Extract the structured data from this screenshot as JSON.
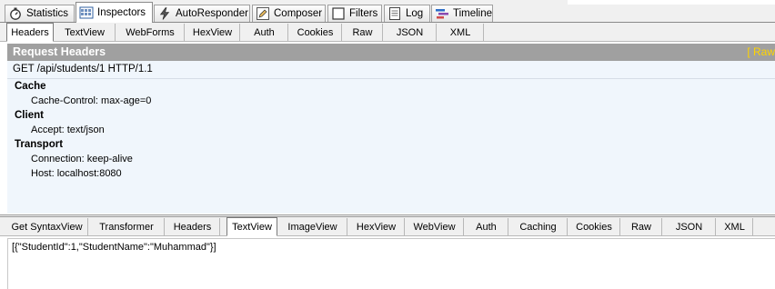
{
  "top_tabs": [
    {
      "label": "Statistics",
      "icon": "stopwatch-icon"
    },
    {
      "label": "Inspectors",
      "icon": "inspect-icon"
    },
    {
      "label": "AutoResponder",
      "icon": "lightning-icon"
    },
    {
      "label": "Composer",
      "icon": "pencil-icon"
    },
    {
      "label": "Filters",
      "icon": "checkbox-icon"
    },
    {
      "label": "Log",
      "icon": "document-icon"
    },
    {
      "label": "Timeline",
      "icon": "timeline-icon"
    }
  ],
  "request_tabs": [
    "Headers",
    "TextView",
    "WebForms",
    "HexView",
    "Auth",
    "Cookies",
    "Raw",
    "JSON",
    "XML"
  ],
  "request_headers": {
    "title": "Request Headers",
    "raw_link": "[ Raw",
    "request_line": "GET /api/students/1 HTTP/1.1",
    "groups": [
      {
        "name": "Cache",
        "items": [
          "Cache-Control: max-age=0"
        ]
      },
      {
        "name": "Client",
        "items": [
          "Accept: text/json"
        ]
      },
      {
        "name": "Transport",
        "items": [
          "Connection: keep-alive",
          "Host: localhost:8080"
        ]
      }
    ]
  },
  "response_tabs": [
    "Get SyntaxView",
    "Transformer",
    "Headers",
    "TextView",
    "ImageView",
    "HexView",
    "WebView",
    "Auth",
    "Caching",
    "Cookies",
    "Raw",
    "JSON",
    "XML"
  ],
  "response_body": "[{\"StudentId\":1,\"StudentName\":\"Muhammad\"}]",
  "colors": {
    "header_bar": "#a0a0a0",
    "raw_link": "#ffd400",
    "headers_bg": "#f0f6fc"
  }
}
